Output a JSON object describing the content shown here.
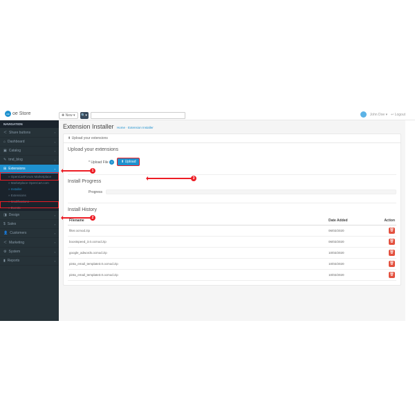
{
  "brand": {
    "name": "oe Store"
  },
  "header": {
    "new_label": "New",
    "username": "John Doe",
    "logout": "Logout"
  },
  "sidebar": {
    "heading": "NAVIGATION",
    "items": [
      {
        "icon": "＜",
        "label": "Share buttons"
      },
      {
        "icon": "⌂",
        "label": "Dashboard"
      },
      {
        "icon": "▣",
        "label": "Catalog"
      },
      {
        "icon": "✎",
        "label": "tmd_blog"
      },
      {
        "icon": "⊞",
        "label": "Extensions",
        "active": true,
        "children": [
          {
            "label": "OpenCartForum Marketplace"
          },
          {
            "label": "Marketplace OpenCart.com"
          },
          {
            "label": "Installer",
            "hl": true
          },
          {
            "label": "Extensions"
          },
          {
            "label": "Modifications"
          },
          {
            "label": "Events"
          }
        ]
      },
      {
        "icon": "◨",
        "label": "Design"
      },
      {
        "icon": "$",
        "label": "Sales"
      },
      {
        "icon": "👤",
        "label": "Customers"
      },
      {
        "icon": "＜",
        "label": "Marketing"
      },
      {
        "icon": "⚙",
        "label": "System"
      },
      {
        "icon": "▮",
        "label": "Reports"
      }
    ]
  },
  "page": {
    "title": "Extension Installer",
    "breadcrumb_home": "Home",
    "breadcrumb_current": "Extension Installer"
  },
  "panel": {
    "header": "Upload your extensions",
    "upload_section": "Upload your extensions",
    "upload_field_label": "* Upload File",
    "upload_btn": "Upload",
    "progress_section": "Install Progress",
    "progress_label": "Progress",
    "history_section": "Install History",
    "cols": {
      "filename": "Filename",
      "date": "Date Added",
      "action": "Action"
    },
    "rows": [
      {
        "filename": "filter.ocmod.zip",
        "date": "06/02/2020"
      },
      {
        "filename": "boostspeed_3.0.ocmod.zip",
        "date": "06/02/2020"
      },
      {
        "filename": "google_adwords.ocmod.zip",
        "date": "10/02/2020"
      },
      {
        "filename": "pinta_email_template3.0.ocmod.zip",
        "date": "10/02/2020"
      },
      {
        "filename": "pinta_email_template3.0.ocmod.zip",
        "date": "10/02/2020"
      }
    ]
  },
  "callouts": {
    "one": "1",
    "two": "2",
    "three": "3"
  }
}
